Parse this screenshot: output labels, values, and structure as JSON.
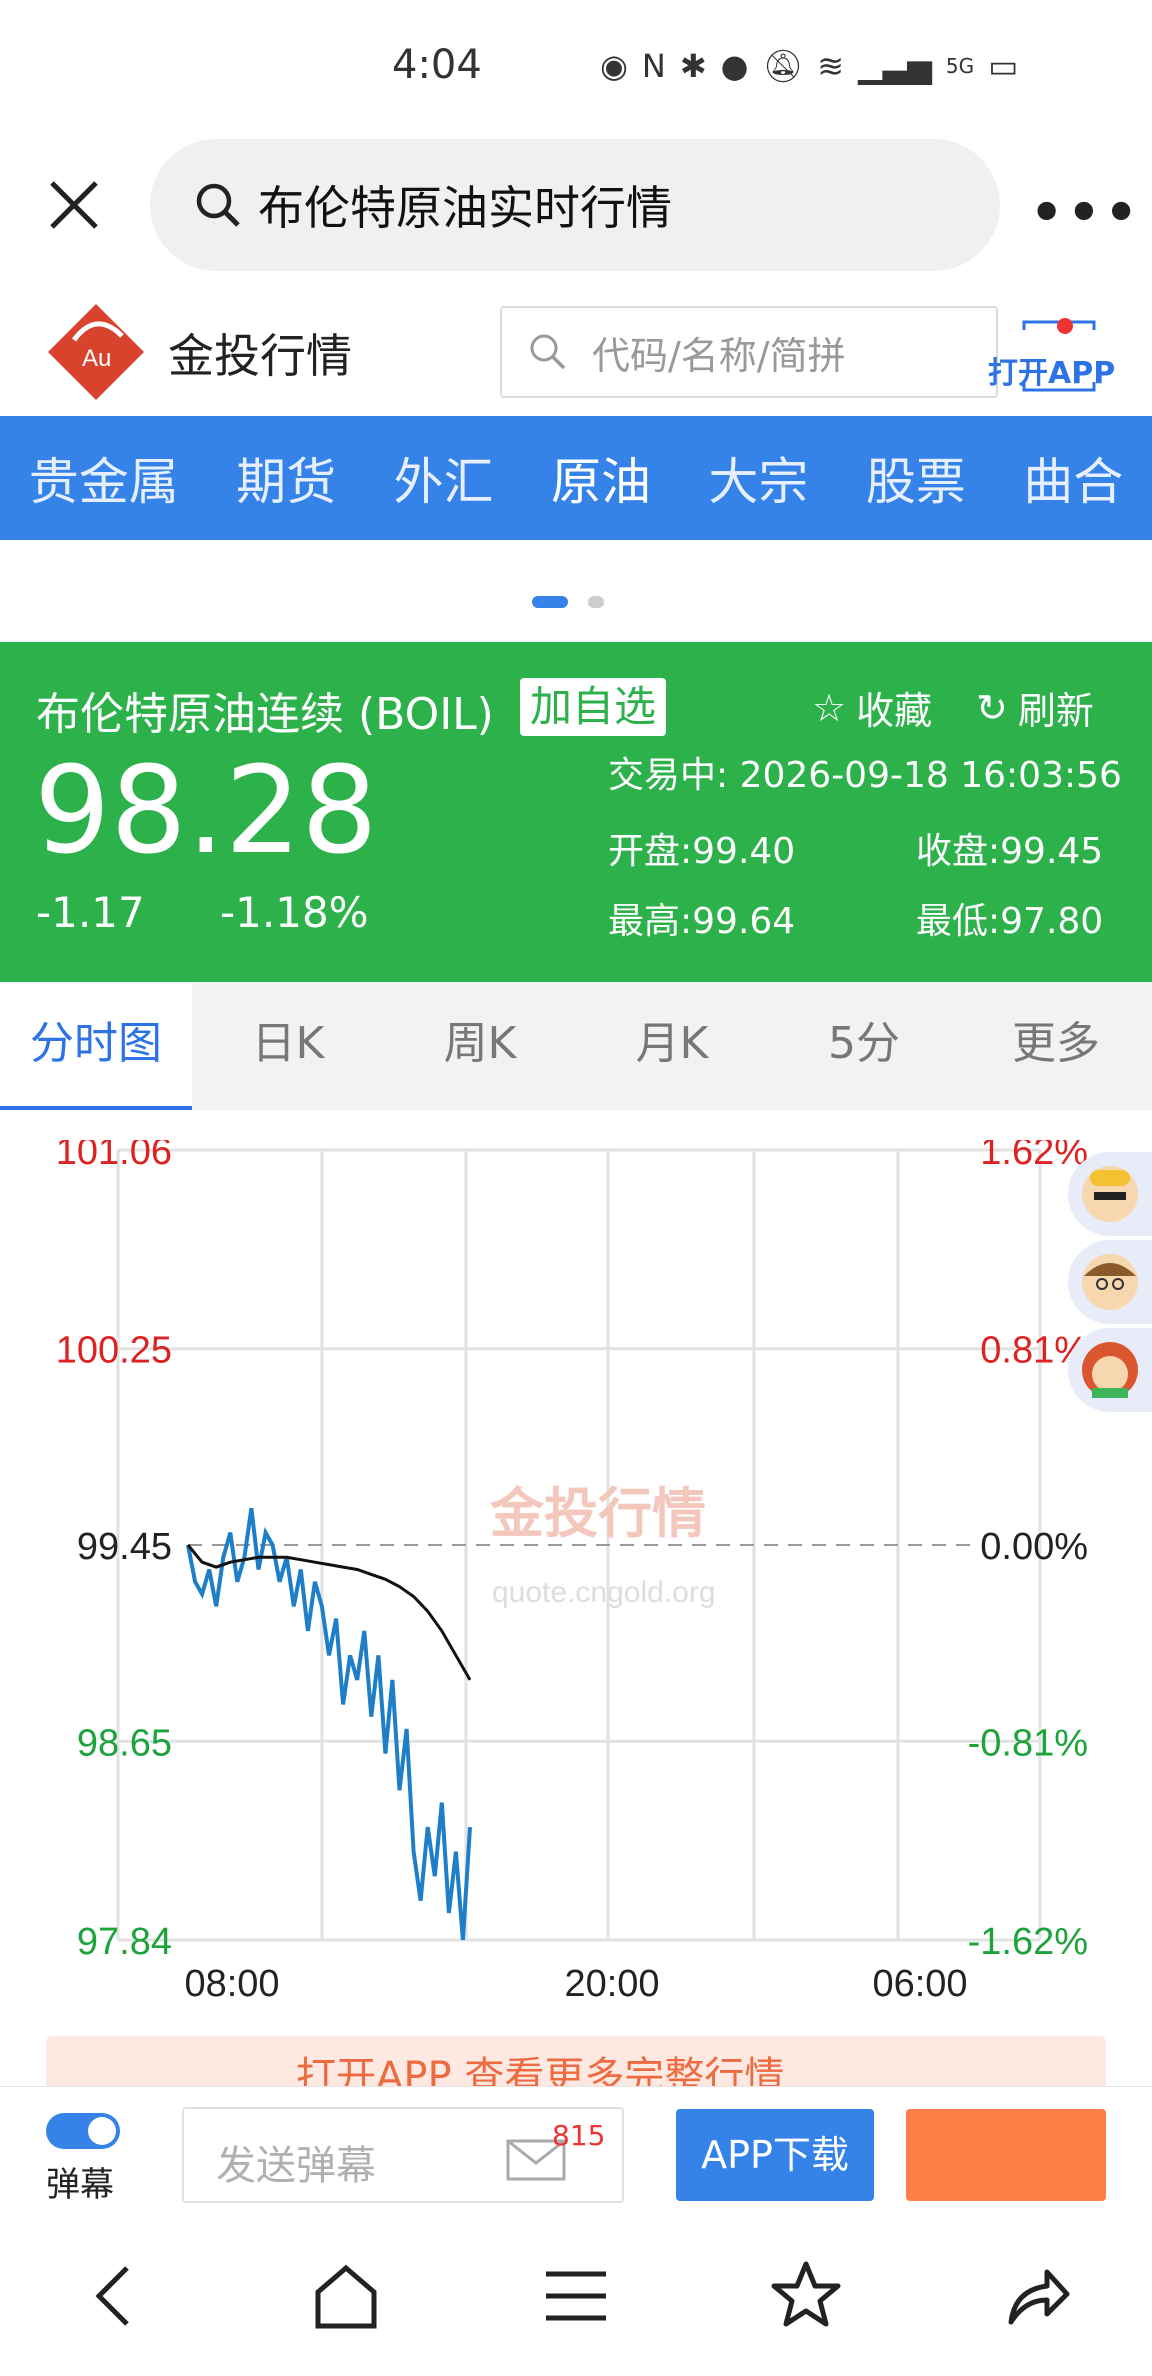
{
  "status_bar": {
    "time": "4:04",
    "signal": "5G"
  },
  "browser": {
    "search_text": "布伦特原油实时行情",
    "more": "•••"
  },
  "site": {
    "name": "金投行情",
    "search_placeholder": "代码/名称/简拼",
    "open_app": "打开APP",
    "logo_text": "Au"
  },
  "nav_tabs": [
    "贵金属",
    "期货",
    "外汇",
    "原油",
    "大宗",
    "股票",
    "曲合"
  ],
  "quote": {
    "name": "布伦特原油连续 (BOIL)",
    "add_watch": "加自选",
    "favorite": "收藏",
    "refresh": "刷新",
    "price": "98.28",
    "change": "-1.17",
    "change_pct": "-1.18%",
    "status": "交易中: 2026-09-18 16:03:56",
    "open": "开盘:99.40",
    "prev_close": "收盘:99.45",
    "high": "最高:99.64",
    "low": "最低:97.80"
  },
  "chart_tabs": [
    "分时图",
    "日K",
    "周K",
    "月K",
    "5分",
    "更多"
  ],
  "chart_data": {
    "type": "line",
    "y_left_labels": [
      "101.06",
      "100.25",
      "99.45",
      "98.65",
      "97.84"
    ],
    "y_right_labels": [
      "1.62%",
      "0.81%",
      "0.00%",
      "-0.81%",
      "-1.62%"
    ],
    "x_labels": [
      "08:00",
      "20:00",
      "06:00"
    ],
    "ylim": [
      97.84,
      101.06
    ],
    "reference": 99.45,
    "watermark": "金投行情",
    "watermark_url": "quote.cngold.org",
    "series": [
      {
        "values": [
          99.45,
          99.3,
          99.25,
          99.35,
          99.2,
          99.4,
          99.5,
          99.3,
          99.4,
          99.6,
          99.35,
          99.5,
          99.45,
          99.3,
          99.4,
          99.2,
          99.35,
          99.1,
          99.3,
          99.2,
          99.0,
          99.15,
          98.8,
          99.0,
          98.9,
          99.1,
          98.75,
          99.0,
          98.6,
          98.9,
          98.45,
          98.7,
          98.2,
          98.0,
          98.3,
          98.1,
          98.4,
          97.95,
          98.2,
          97.84,
          98.3
        ],
        "color": "#1e7ec8"
      },
      {
        "values": [
          99.45,
          99.38,
          99.36,
          99.38,
          99.39,
          99.4,
          99.4,
          99.4,
          99.39,
          99.38,
          99.37,
          99.36,
          99.35,
          99.33,
          99.31,
          99.28,
          99.24,
          99.18,
          99.1,
          99.0,
          98.9
        ],
        "color": "#111111"
      }
    ]
  },
  "promo": "打开APP 查看更多完整行情",
  "bottom": {
    "toggle_label": "弹幕",
    "input_placeholder": "发送弹幕",
    "mail_count": "815",
    "app_download": "APP下载"
  }
}
